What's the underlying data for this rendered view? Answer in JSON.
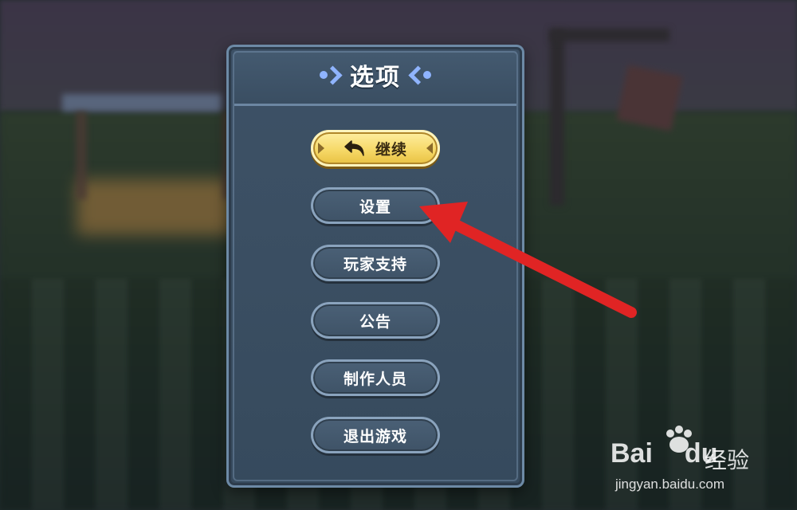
{
  "dialog": {
    "title": "选项",
    "buttons": [
      {
        "id": "continue",
        "label": "继续",
        "icon": "back-arrow-icon"
      },
      {
        "id": "settings",
        "label": "设置"
      },
      {
        "id": "support",
        "label": "玩家支持"
      },
      {
        "id": "announcement",
        "label": "公告"
      },
      {
        "id": "credits",
        "label": "制作人员"
      },
      {
        "id": "quit",
        "label": "退出游戏"
      }
    ]
  },
  "annotation": {
    "type": "red-arrow",
    "target": "settings",
    "color": "#e02424"
  },
  "watermark": {
    "logo_text": "Bai",
    "logo_suffix": "du",
    "brand_cn": "经验",
    "url": "jingyan.baidu.com"
  },
  "colors": {
    "primary_button": "#f6d968",
    "panel": "#3b4f63",
    "title_deco": "#8fb4ff"
  }
}
